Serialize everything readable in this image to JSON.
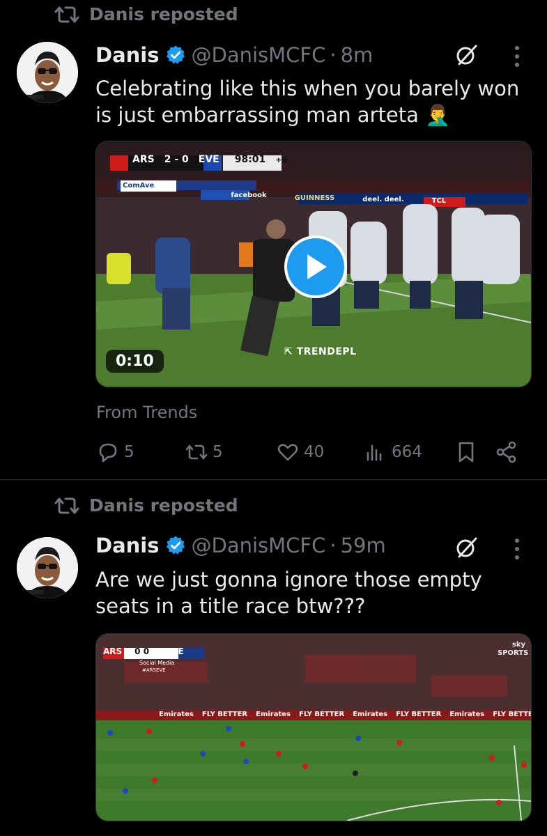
{
  "posts": [
    {
      "repost_label": "Danis reposted",
      "author_name": "Danis",
      "handle": "@DanisMCFC",
      "dot": "·",
      "time": "8m",
      "text": "Celebrating like this when you barely won is just embarrassing man arteta 🤦‍♂️",
      "video": {
        "duration": "0:10",
        "score_home": "ARS",
        "score": "2 - 0",
        "score_away": "EVE",
        "clock": "98:01",
        "added_time": "+6",
        "watermark": "TRENDEPL",
        "sponsor_boards": [
          "ComAve",
          "facebook",
          "GUINNESS",
          "deel. deel.",
          "TCL"
        ]
      },
      "source": "From Trends",
      "stats": {
        "replies": "5",
        "reposts": "5",
        "likes": "40",
        "views": "664"
      }
    },
    {
      "repost_label": "Danis reposted",
      "author_name": "Danis",
      "handle": "@DanisMCFC",
      "dot": "·",
      "time": "59m",
      "text": "Are we just gonna ignore those empty seats in a title race btw???",
      "image": {
        "score_home": "ARS",
        "score": "0 0",
        "score_away": "EVE",
        "sub_label": "Social Media",
        "hashtag": "#ARSEVE",
        "boards": [
          "Emirates",
          "FLY BETTER",
          "Emirates",
          "FLY BETTER",
          "Emirates",
          "FLY BETTER",
          "Emirates",
          "FLY BETTER"
        ],
        "broadcaster": "sky SPORTS"
      }
    }
  ],
  "colors": {
    "accent": "#1d9bf0",
    "muted": "#71767b",
    "text": "#e7e9ea",
    "background": "#000000",
    "pitch": "#3f7a2c"
  }
}
